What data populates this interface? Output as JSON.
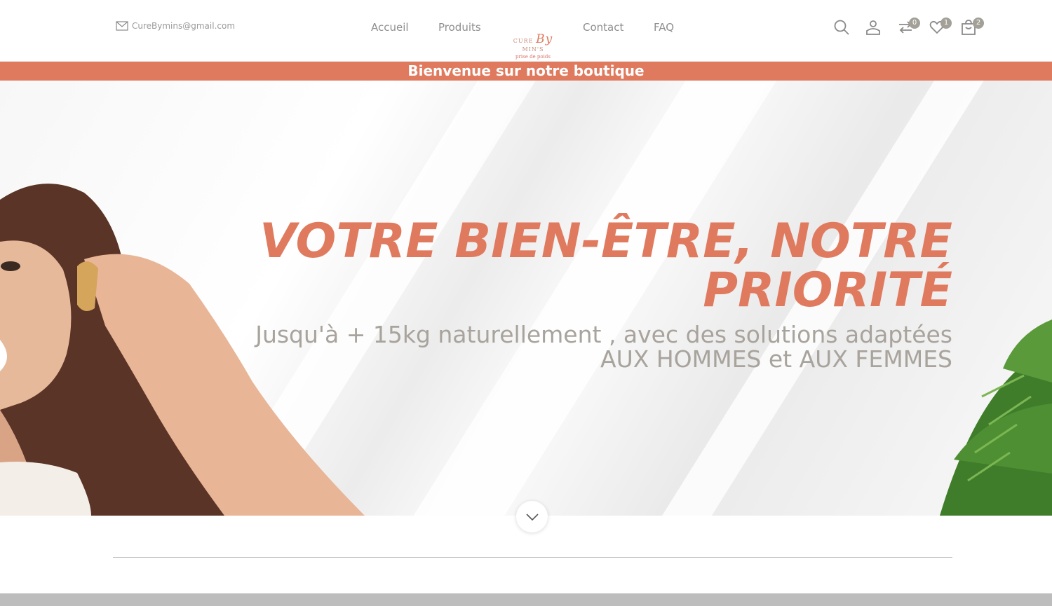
{
  "header": {
    "email": "CureBymins@gmail.com",
    "nav": [
      "Accueil",
      "Produits",
      "Contact",
      "FAQ"
    ],
    "logo": {
      "top": "CURE",
      "script": "By",
      "right": "MIN'S",
      "tagline": "prise de poids"
    },
    "badges": {
      "compare": "0",
      "wishlist": "1",
      "cart": "2"
    }
  },
  "banner": {
    "text": "Bienvenue sur notre boutique"
  },
  "hero": {
    "headline_1": "VOTRE BIEN-ÊTRE, NOTRE",
    "headline_2": "PRIORITÉ",
    "subtitle_1": "Jusqu'à + 15kg naturellement , avec des solutions adaptées",
    "subtitle_2": "AUX HOMMES et AUX FEMMES"
  },
  "colors": {
    "accent": "#e07a5f",
    "text_muted": "#8f8f8f",
    "subtitle": "#a8a39c",
    "badge": "#a3a097"
  }
}
